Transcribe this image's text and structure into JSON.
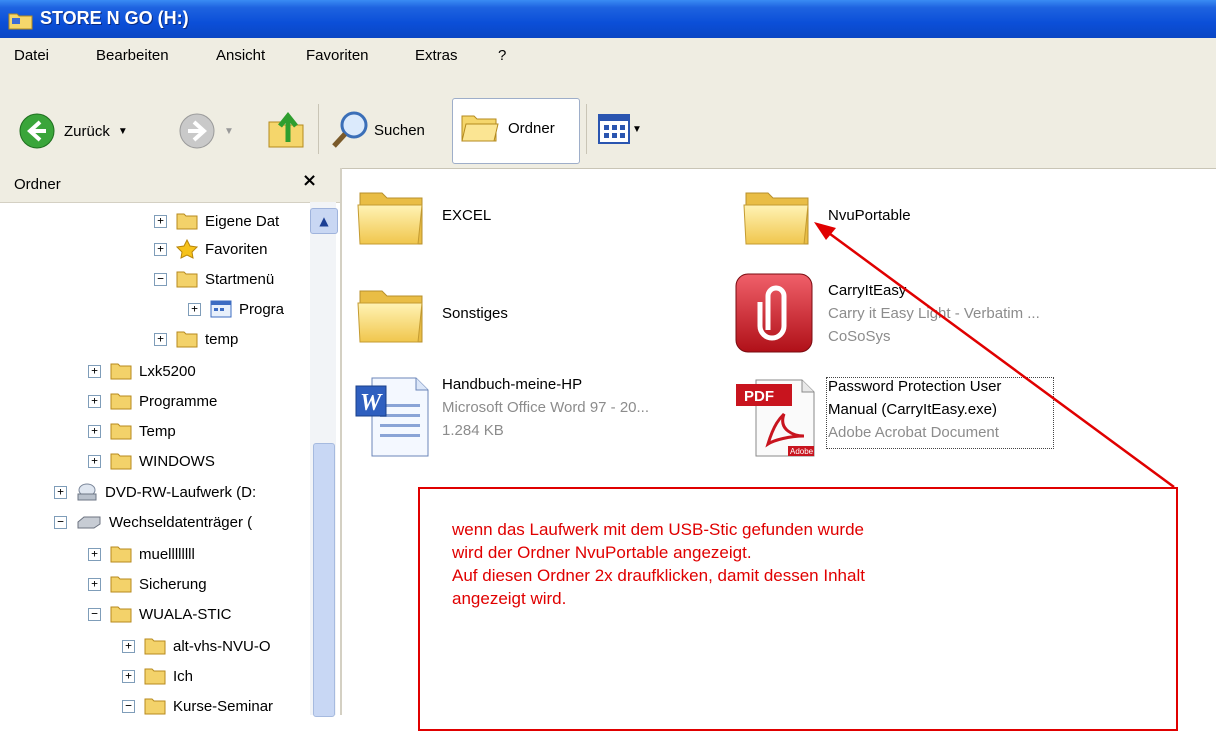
{
  "window": {
    "title": "STORE N GO (H:)"
  },
  "menu": [
    "Datei",
    "Bearbeiten",
    "Ansicht",
    "Favoriten",
    "Extras",
    "?"
  ],
  "toolbar": {
    "back_label": "Zurück",
    "search_label": "Suchen",
    "folders_label": "Ordner"
  },
  "left_pane": {
    "title": "Ordner",
    "close_glyph": "×",
    "tree": [
      {
        "label": "Eigene Dat",
        "expander": "+"
      },
      {
        "label": "Favoriten",
        "expander": "+"
      },
      {
        "label": "Startmenü",
        "expander": "−"
      },
      {
        "label": "Progra",
        "expander": "+"
      },
      {
        "label": "temp",
        "expander": "+"
      },
      {
        "label": "Lxk5200",
        "expander": "+"
      },
      {
        "label": "Programme",
        "expander": "+"
      },
      {
        "label": "Temp",
        "expander": "+"
      },
      {
        "label": "WINDOWS",
        "expander": "+"
      },
      {
        "label": "DVD-RW-Laufwerk (D:",
        "expander": "+"
      },
      {
        "label": "Wechseldatenträger (",
        "expander": "−"
      },
      {
        "label": "muellllllll",
        "expander": "+"
      },
      {
        "label": "Sicherung",
        "expander": "+"
      },
      {
        "label": "WUALA-STIC",
        "expander": "−"
      },
      {
        "label": "alt-vhs-NVU-O",
        "expander": "+"
      },
      {
        "label": "Ich",
        "expander": "+"
      },
      {
        "label": "Kurse-Seminar",
        "expander": "−"
      }
    ]
  },
  "files": [
    {
      "name": "EXCEL",
      "line2": "",
      "line3": ""
    },
    {
      "name": "NvuPortable",
      "line2": "",
      "line3": ""
    },
    {
      "name": "Sonstiges",
      "line2": "",
      "line3": ""
    },
    {
      "name": "CarryItEasy",
      "line2": "Carry it Easy Light - Verbatim ...",
      "line3": "CoSoSys"
    },
    {
      "name": "Handbuch-meine-HP",
      "line2": "Microsoft Office Word 97 - 20...",
      "line3": "1.284 KB"
    },
    {
      "name": "Password Protection User",
      "line2": "Manual (CarryItEasy.exe)",
      "line3": "Adobe Acrobat Document"
    }
  ],
  "pdf_badge": "PDF",
  "adobe_text": "Adobe",
  "annotation": {
    "lines": [
      "wenn das Laufwerk mit dem USB-Stic gefunden wurde",
      "wird der Ordner NvuPortable angezeigt.",
      "Auf diesen Ordner 2x draufklicken, damit dessen Inhalt",
      "angezeigt wird."
    ]
  },
  "colors": {
    "titlebar": "#0b4fd8",
    "annotation": "#e00000",
    "chrome": "#efede2"
  }
}
